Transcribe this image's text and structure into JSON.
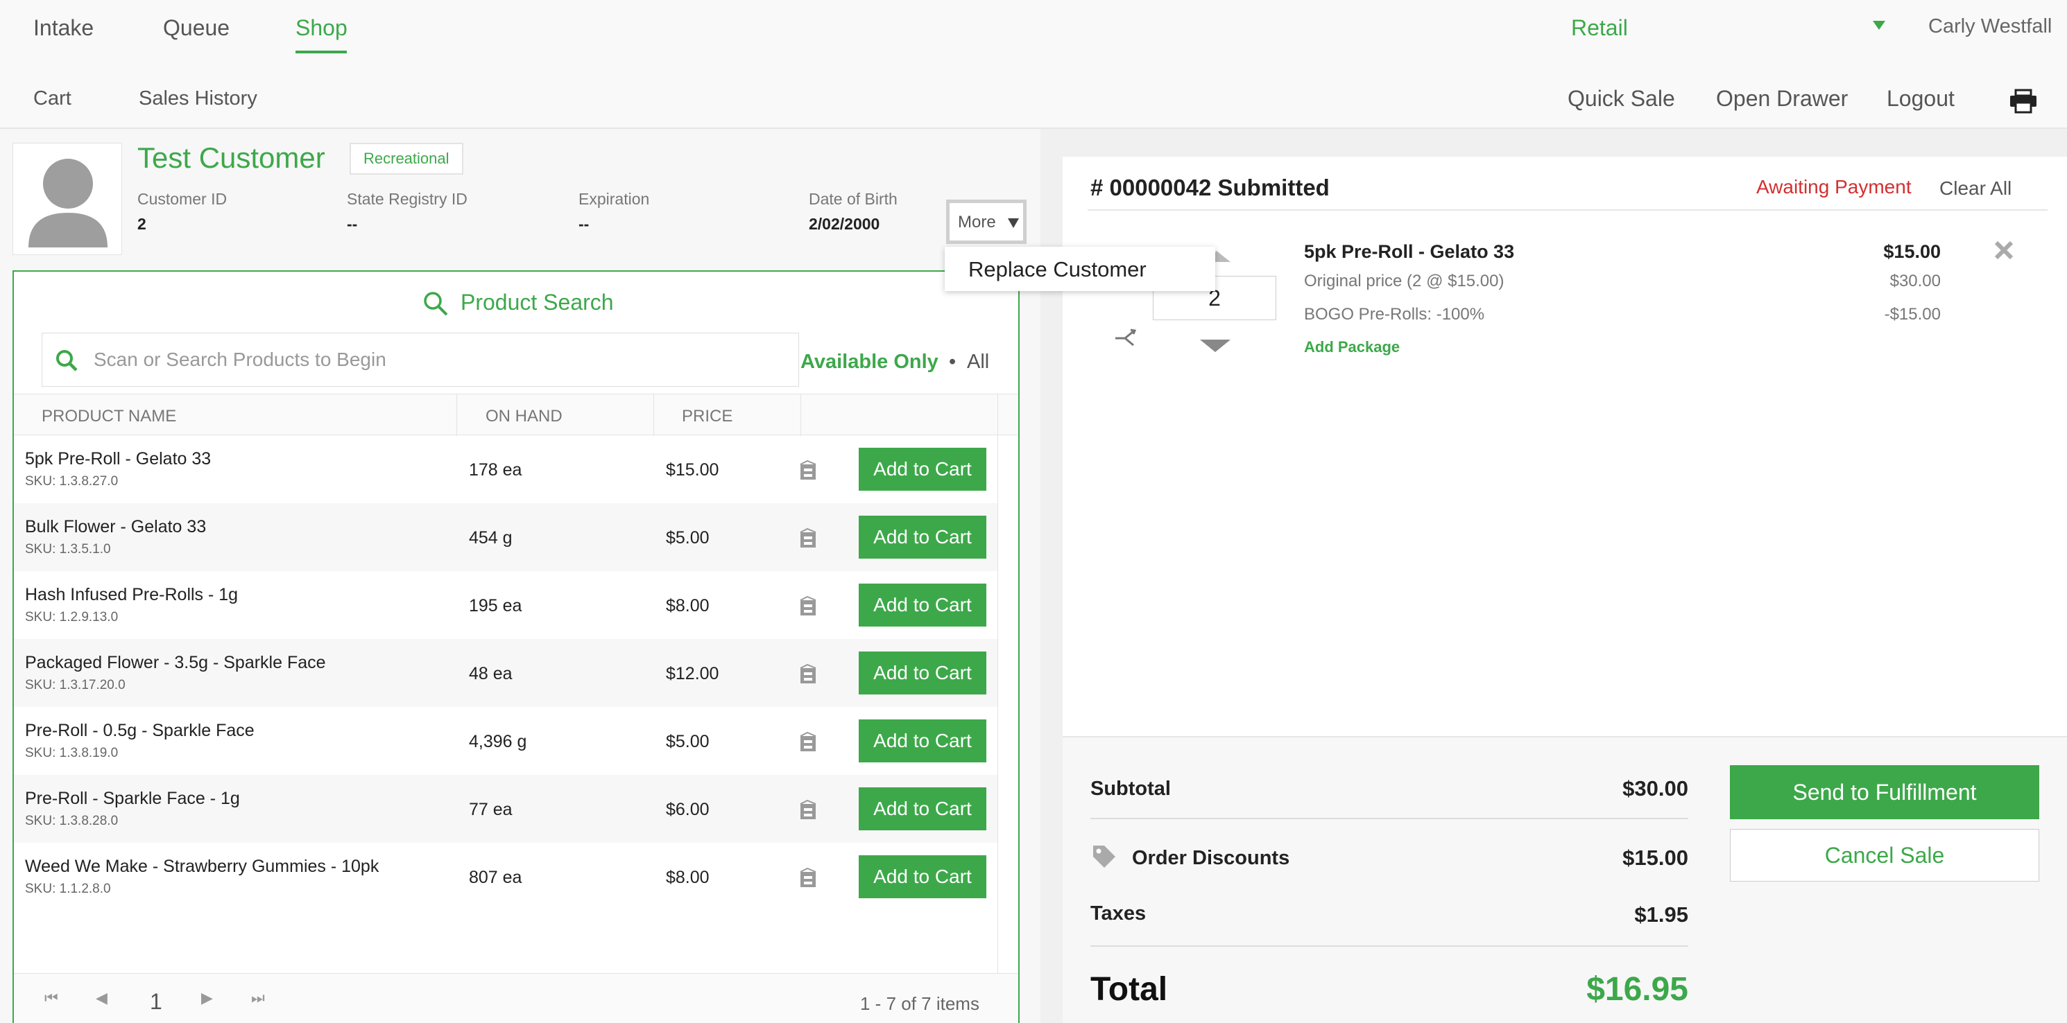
{
  "nav": {
    "tabs": [
      {
        "label": "Intake"
      },
      {
        "label": "Queue"
      },
      {
        "label": "Shop"
      }
    ],
    "store": "Retail",
    "user": "Carly Westfall"
  },
  "subnav": {
    "links": [
      "Cart",
      "Sales History"
    ],
    "actions": [
      "Quick Sale",
      "Open Drawer",
      "Logout"
    ]
  },
  "customer": {
    "name": "Test Customer",
    "type": "Recreational",
    "fields": [
      {
        "label": "Customer ID",
        "value": "2"
      },
      {
        "label": "State Registry ID",
        "value": "--"
      },
      {
        "label": "Expiration",
        "value": "--"
      },
      {
        "label": "Date of Birth",
        "value": "2/02/2000"
      }
    ],
    "more_label": "More",
    "menu_item": "Replace Customer"
  },
  "search": {
    "title": "Product Search",
    "placeholder": "Scan or Search Products to Begin",
    "filter_available": "Available Only",
    "filter_dot": "•",
    "filter_all": "All"
  },
  "table": {
    "headers": [
      "PRODUCT NAME",
      "ON HAND",
      "PRICE"
    ],
    "add_label": "Add to Cart",
    "rows": [
      {
        "name": "5pk Pre-Roll - Gelato 33",
        "sku": "SKU: 1.3.8.27.0",
        "on_hand": "178 ea",
        "price": "$15.00"
      },
      {
        "name": "Bulk Flower - Gelato 33",
        "sku": "SKU: 1.3.5.1.0",
        "on_hand": "454 g",
        "price": "$5.00"
      },
      {
        "name": "Hash Infused Pre-Rolls - 1g",
        "sku": "SKU: 1.2.9.13.0",
        "on_hand": "195 ea",
        "price": "$8.00"
      },
      {
        "name": "Packaged Flower - 3.5g - Sparkle Face",
        "sku": "SKU: 1.3.17.20.0",
        "on_hand": "48 ea",
        "price": "$12.00"
      },
      {
        "name": "Pre-Roll - 0.5g - Sparkle Face",
        "sku": "SKU: 1.3.8.19.0",
        "on_hand": "4,396 g",
        "price": "$5.00"
      },
      {
        "name": "Pre-Roll - Sparkle Face - 1g",
        "sku": "SKU: 1.3.8.28.0",
        "on_hand": "77 ea",
        "price": "$6.00"
      },
      {
        "name": "Weed We Make - Strawberry Gummies - 10pk",
        "sku": "SKU: 1.1.2.8.0",
        "on_hand": "807 ea",
        "price": "$8.00"
      }
    ]
  },
  "pager": {
    "page": "1",
    "info": "1 - 7 of 7 items"
  },
  "order": {
    "title": "# 00000042 Submitted",
    "status": "Awaiting Payment",
    "clear_all": "Clear All",
    "item": {
      "quantity": "2",
      "name": "5pk Pre-Roll - Gelato 33",
      "original": "Original price (2 @ $15.00)",
      "discount": "BOGO Pre-Rolls:  -100%",
      "add_package": "Add Package",
      "price": "$15.00",
      "original_amount": "$30.00",
      "discount_amount": "-$15.00"
    },
    "summary": {
      "subtotal_label": "Subtotal",
      "subtotal": "$30.00",
      "discounts_label": "Order Discounts",
      "discounts": "$15.00",
      "taxes_label": "Taxes",
      "taxes": "$1.95",
      "total_label": "Total",
      "total": "$16.95"
    },
    "fulfill_label": "Send to Fulfillment",
    "cancel_label": "Cancel Sale"
  },
  "colors": {
    "accent": "#3da84a",
    "alert": "#d32f2f"
  }
}
